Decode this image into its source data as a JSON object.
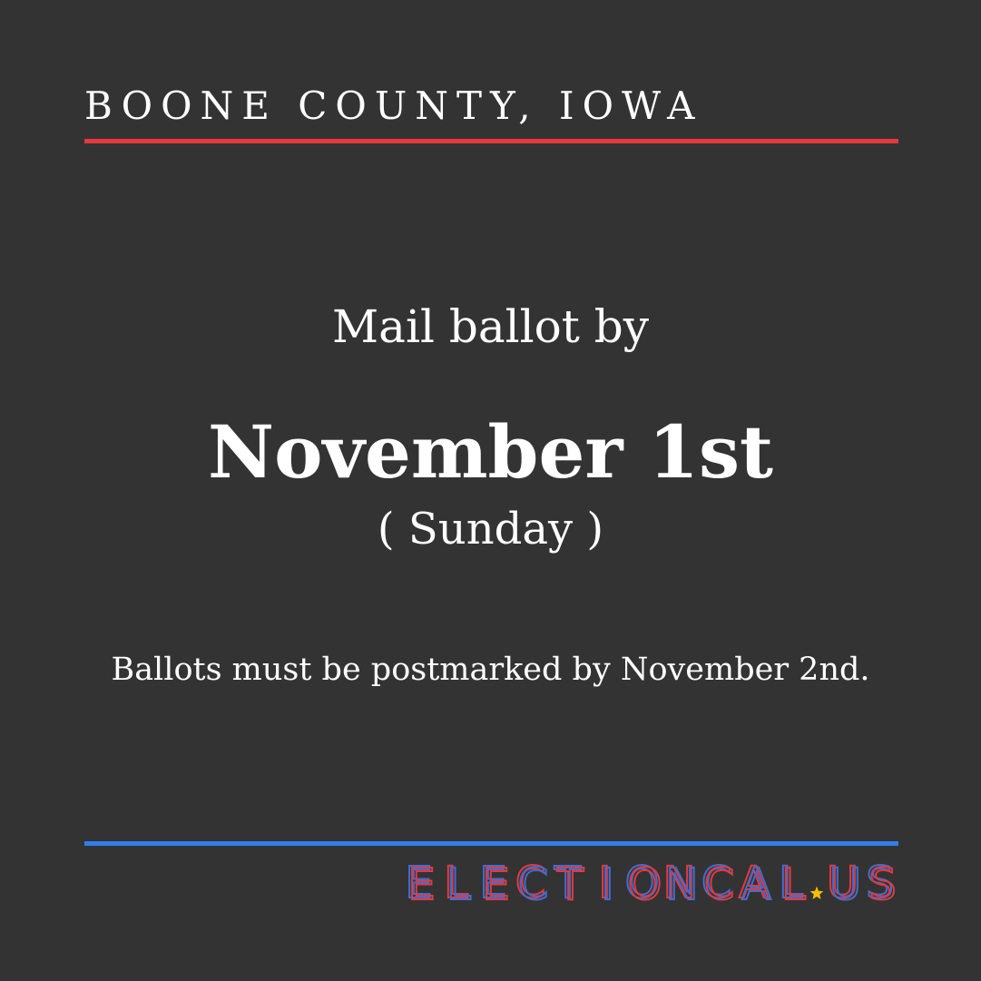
{
  "header": {
    "county": "BOONE COUNTY, IOWA"
  },
  "main": {
    "intro": "Mail ballot by",
    "date": "November 1st",
    "weekday": "( Sunday )",
    "note": "Ballots must be postmarked by November 2nd."
  },
  "logo": {
    "letters_before_star": [
      "E",
      "L",
      "E",
      "C",
      "T",
      "I",
      "O",
      "N",
      "C",
      "A",
      "L"
    ],
    "letters_after_star": [
      "U",
      "S"
    ],
    "star_icon": "star-icon"
  },
  "colors": {
    "background": "#333333",
    "text": "#ffffff",
    "top_rule": "#e8383b",
    "bottom_rule": "#2f7ef0",
    "logo_red": "#e8383b",
    "logo_blue": "#3b6fd6",
    "star": "#f5c000"
  }
}
